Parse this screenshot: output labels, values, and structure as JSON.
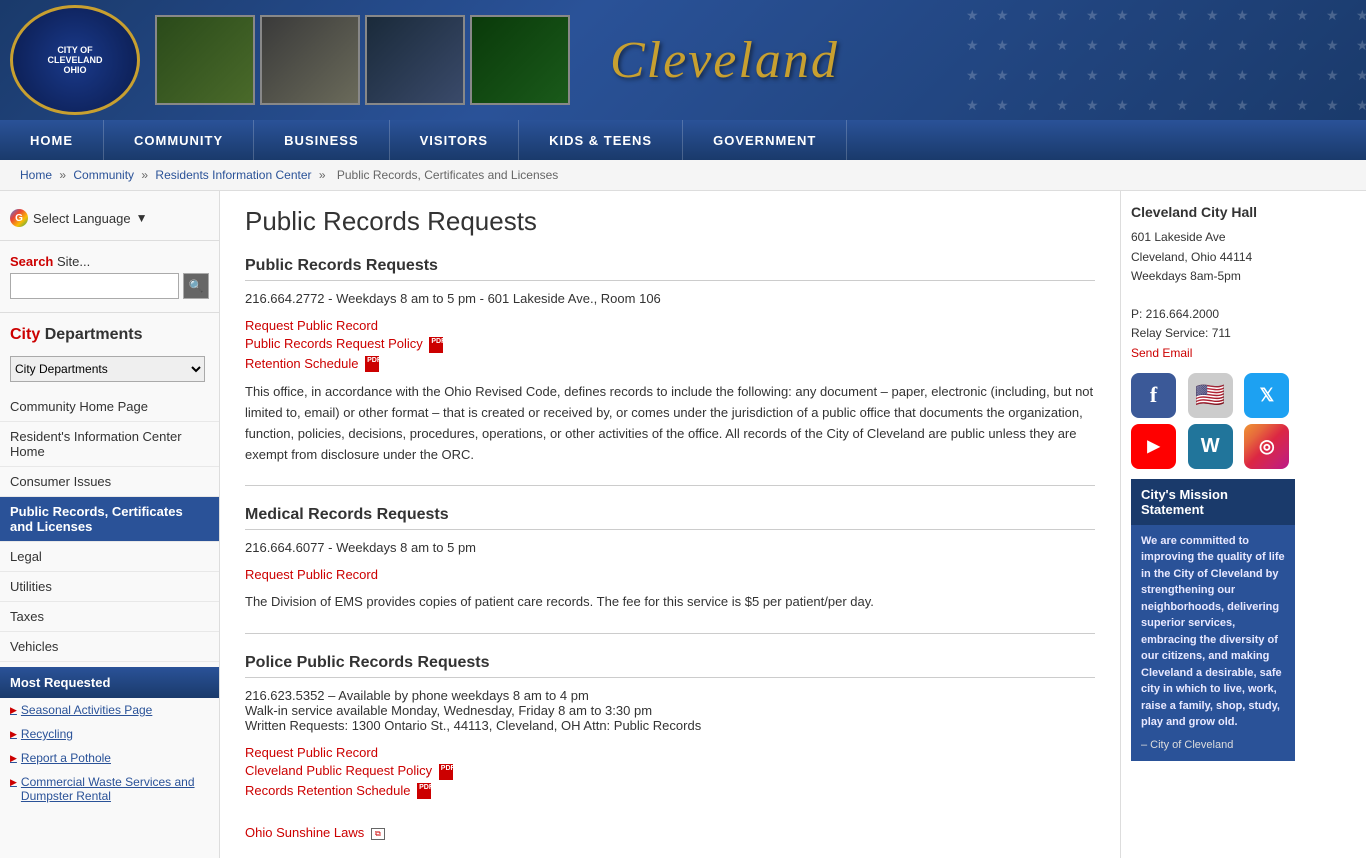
{
  "header": {
    "logo_text": "CITY OF\nCLEVELAND\nOHIO",
    "city_name": "Cleveland",
    "photos": [
      "city-night-photo",
      "bird-sculpture-photo",
      "rock-hall-photo",
      "nature-photo"
    ]
  },
  "nav": {
    "items": [
      "HOME",
      "COMMUNITY",
      "BUSINESS",
      "VISITORS",
      "KIDS & TEENS",
      "GOVERNMENT"
    ]
  },
  "breadcrumb": {
    "items": [
      "Home",
      "Community",
      "Residents Information Center",
      "Public Records, Certificates and Licenses"
    ],
    "separator": "»"
  },
  "sidebar": {
    "select_language_label": "Select Language",
    "search_label": "Search",
    "search_site_label": "Site...",
    "search_placeholder": "",
    "section_title_city": "City",
    "section_title_departments": "Departments",
    "dept_dropdown": {
      "selected": "City Departments",
      "options": [
        "City Departments"
      ]
    },
    "links": [
      {
        "label": "Community Home Page",
        "active": false
      },
      {
        "label": "Resident's Information Center Home",
        "active": false
      },
      {
        "label": "Consumer Issues",
        "active": false
      },
      {
        "label": "Public Records, Certificates and Licenses",
        "active": true
      },
      {
        "label": "Legal",
        "active": false
      },
      {
        "label": "Utilities",
        "active": false
      },
      {
        "label": "Taxes",
        "active": false
      },
      {
        "label": "Vehicles",
        "active": false
      }
    ],
    "most_requested_label": "Most Requested",
    "most_requested_links": [
      "Seasonal Activities Page",
      "Recycling",
      "Report a Pothole",
      "Commercial Waste Services and Dumpster Rental"
    ]
  },
  "content": {
    "page_title": "Public Records Requests",
    "sections": [
      {
        "id": "public-records",
        "title": "Public Records Requests",
        "contact": "216.664.2772 - Weekdays 8 am to 5 pm - 601 Lakeside Ave., Room 106",
        "links": [
          {
            "label": "Request Public Record",
            "type": "link"
          },
          {
            "label": "Public Records Request Policy",
            "type": "pdf"
          },
          {
            "label": "Retention Schedule",
            "type": "pdf"
          }
        ],
        "body": "This office, in accordance with the Ohio Revised Code, defines records to include the following: any document – paper, electronic (including, but not limited to, email) or other format – that is created or received by, or comes under the jurisdiction of a public office that documents the organization, function, policies, decisions, procedures, operations, or other activities of the office. All records of the City of Cleveland are public unless they are exempt from disclosure under the ORC."
      },
      {
        "id": "medical-records",
        "title": "Medical Records Requests",
        "contact": "216.664.6077 - Weekdays 8 am to 5 pm",
        "links": [
          {
            "label": "Request Public Record",
            "type": "link"
          }
        ],
        "body": "The Division of EMS provides copies of patient care records. The fee for this service is $5 per patient/per day."
      },
      {
        "id": "police-records",
        "title": "Police Public Records Requests",
        "contact_lines": [
          "216.623.5352 – Available by phone weekdays 8 am to 4 pm",
          "Walk-in service available Monday, Wednesday, Friday 8 am to 3:30 pm",
          "Written Requests: 1300 Ontario St., 44113, Cleveland, OH Attn: Public Records"
        ],
        "links": [
          {
            "label": "Request Public Record",
            "type": "link"
          },
          {
            "label": "Cleveland Public Request Policy",
            "type": "pdf"
          },
          {
            "label": "Records Retention Schedule",
            "type": "pdf"
          }
        ],
        "extra_links": [
          {
            "label": "Ohio Sunshine Laws",
            "type": "ext"
          }
        ]
      }
    ]
  },
  "right_sidebar": {
    "city_hall": {
      "name": "Cleveland City Hall",
      "address1": "601 Lakeside Ave",
      "address2": "Cleveland, Ohio 44114",
      "hours": "Weekdays 8am-5pm",
      "phone": "P: 216.664.2000",
      "relay": "Relay Service: 711",
      "email_label": "Send Email"
    },
    "social_icons": [
      {
        "name": "facebook",
        "class": "si-fb",
        "symbol": "f"
      },
      {
        "name": "us-flag",
        "class": "si-us",
        "symbol": "🇺🇸"
      },
      {
        "name": "twitter",
        "class": "si-tw",
        "symbol": "t"
      },
      {
        "name": "youtube",
        "class": "si-yt",
        "symbol": "▶"
      },
      {
        "name": "wordpress",
        "class": "si-wp",
        "symbol": "W"
      },
      {
        "name": "instagram",
        "class": "si-ig",
        "symbol": "◎"
      }
    ],
    "mission": {
      "title": "City's Mission Statement",
      "text": "We are committed to improving the quality of life in the City of Cleveland by strengthening our neighborhoods, delivering superior services, embracing the diversity of our citizens, and making Cleveland a desirable, safe city in which to live, work, raise a family, shop, study, play and grow old.",
      "signature": "– City of Cleveland"
    }
  }
}
